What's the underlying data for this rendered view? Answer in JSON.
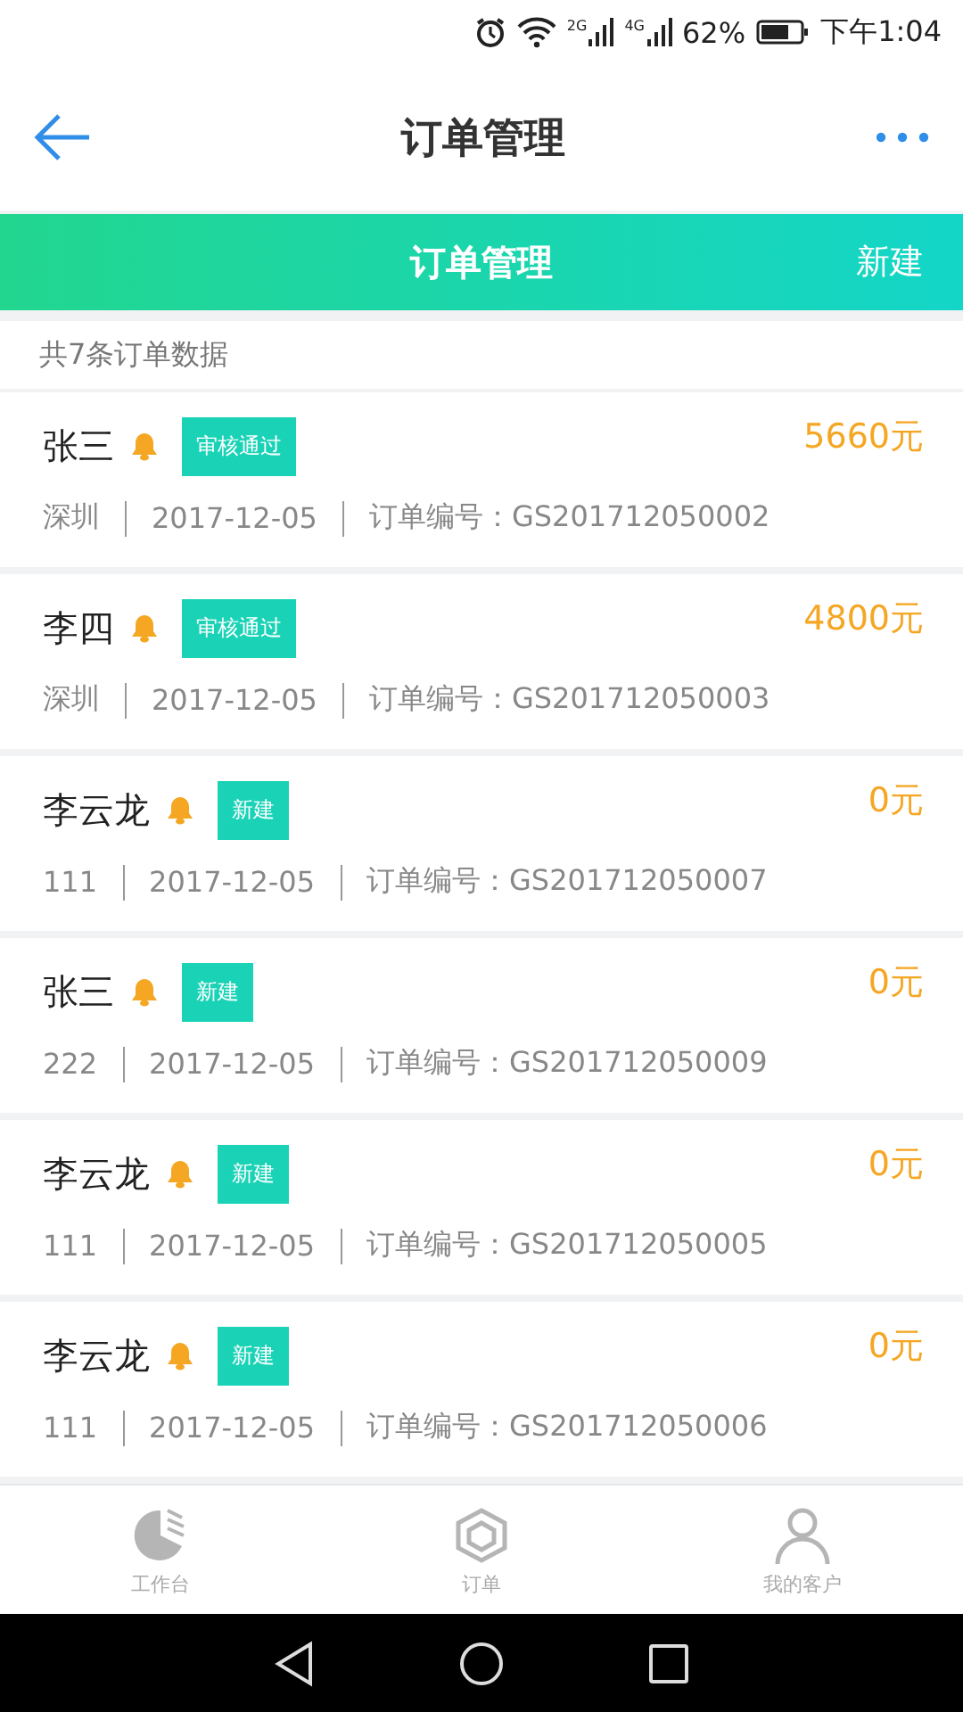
{
  "status_bar": {
    "network_2g": "2G",
    "network_4g": "4G",
    "battery": "62%",
    "time": "下午1:04"
  },
  "header": {
    "title": "订单管理"
  },
  "band": {
    "title": "订单管理",
    "action": "新建"
  },
  "summary": "共7条订单数据",
  "orders": [
    {
      "name": "张三",
      "status": "审核通过",
      "amount": "5660元",
      "place": "深圳",
      "date": "2017-12-05",
      "number": "订单编号：GS201712050002"
    },
    {
      "name": "李四",
      "status": "审核通过",
      "amount": "4800元",
      "place": "深圳",
      "date": "2017-12-05",
      "number": "订单编号：GS201712050003"
    },
    {
      "name": "李云龙",
      "status": "新建",
      "amount": "0元",
      "place": "111",
      "date": "2017-12-05",
      "number": "订单编号：GS201712050007"
    },
    {
      "name": "张三",
      "status": "新建",
      "amount": "0元",
      "place": "222",
      "date": "2017-12-05",
      "number": "订单编号：GS201712050009"
    },
    {
      "name": "李云龙",
      "status": "新建",
      "amount": "0元",
      "place": "111",
      "date": "2017-12-05",
      "number": "订单编号：GS201712050005"
    },
    {
      "name": "李云龙",
      "status": "新建",
      "amount": "0元",
      "place": "111",
      "date": "2017-12-05",
      "number": "订单编号：GS201712050006"
    }
  ],
  "tabs": [
    {
      "label": "工作台",
      "selected": false
    },
    {
      "label": "订单",
      "selected": false
    },
    {
      "label": "我的客户",
      "selected": false
    }
  ]
}
